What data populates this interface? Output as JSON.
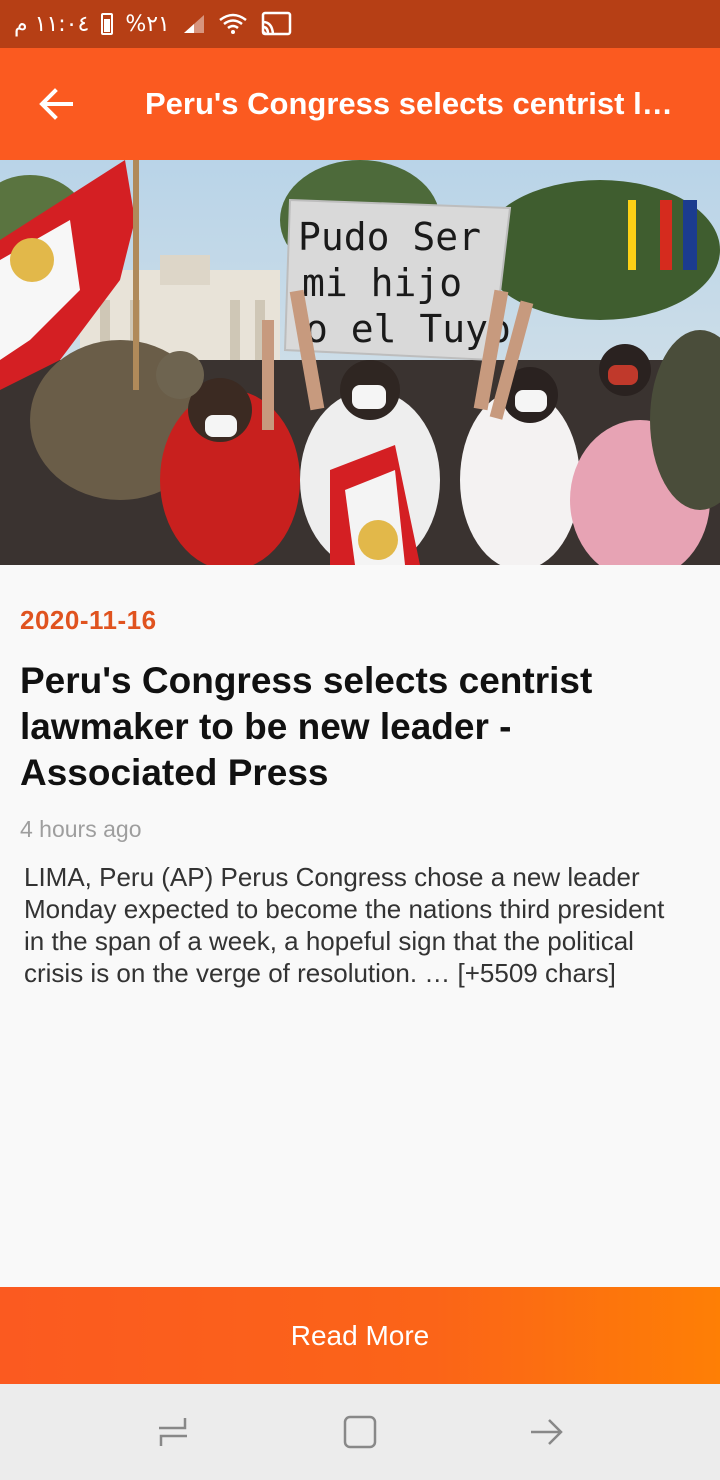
{
  "status_bar": {
    "time": "١١:٠٤ م",
    "battery": "%٢١"
  },
  "app_bar": {
    "title": "Peru's Congress selects centrist lawmaker to be new leader - Associated Press"
  },
  "hero": {
    "sign_text": [
      "Pudo Ser",
      "mi hijo",
      "o el Tuyo"
    ]
  },
  "article": {
    "date": "2020-11-16",
    "headline": "Peru's Congress selects centrist lawmaker to be new leader - Associated Press",
    "time_ago": "4 hours ago",
    "description": "LIMA, Peru (AP) Perus Congress chose a new leader Monday expected to become the nations third president in the span of a week, a hopeful sign that the political crisis is on the verge of resolution. … [+5509 chars]"
  },
  "actions": {
    "read_more_label": "Read More"
  },
  "colors": {
    "status_bar": "#b63f15",
    "app_bar": "#fb5a20",
    "date_accent": "#e0531f",
    "read_more_start": "#fb5a20",
    "read_more_end": "#fe7f05"
  },
  "icons": {
    "back": "arrow-back-icon",
    "battery": "battery-icon",
    "signal": "signal-icon",
    "wifi": "wifi-icon",
    "cast": "cast-icon",
    "recents": "recents-icon",
    "home": "home-icon",
    "back_nav": "back-nav-icon"
  }
}
